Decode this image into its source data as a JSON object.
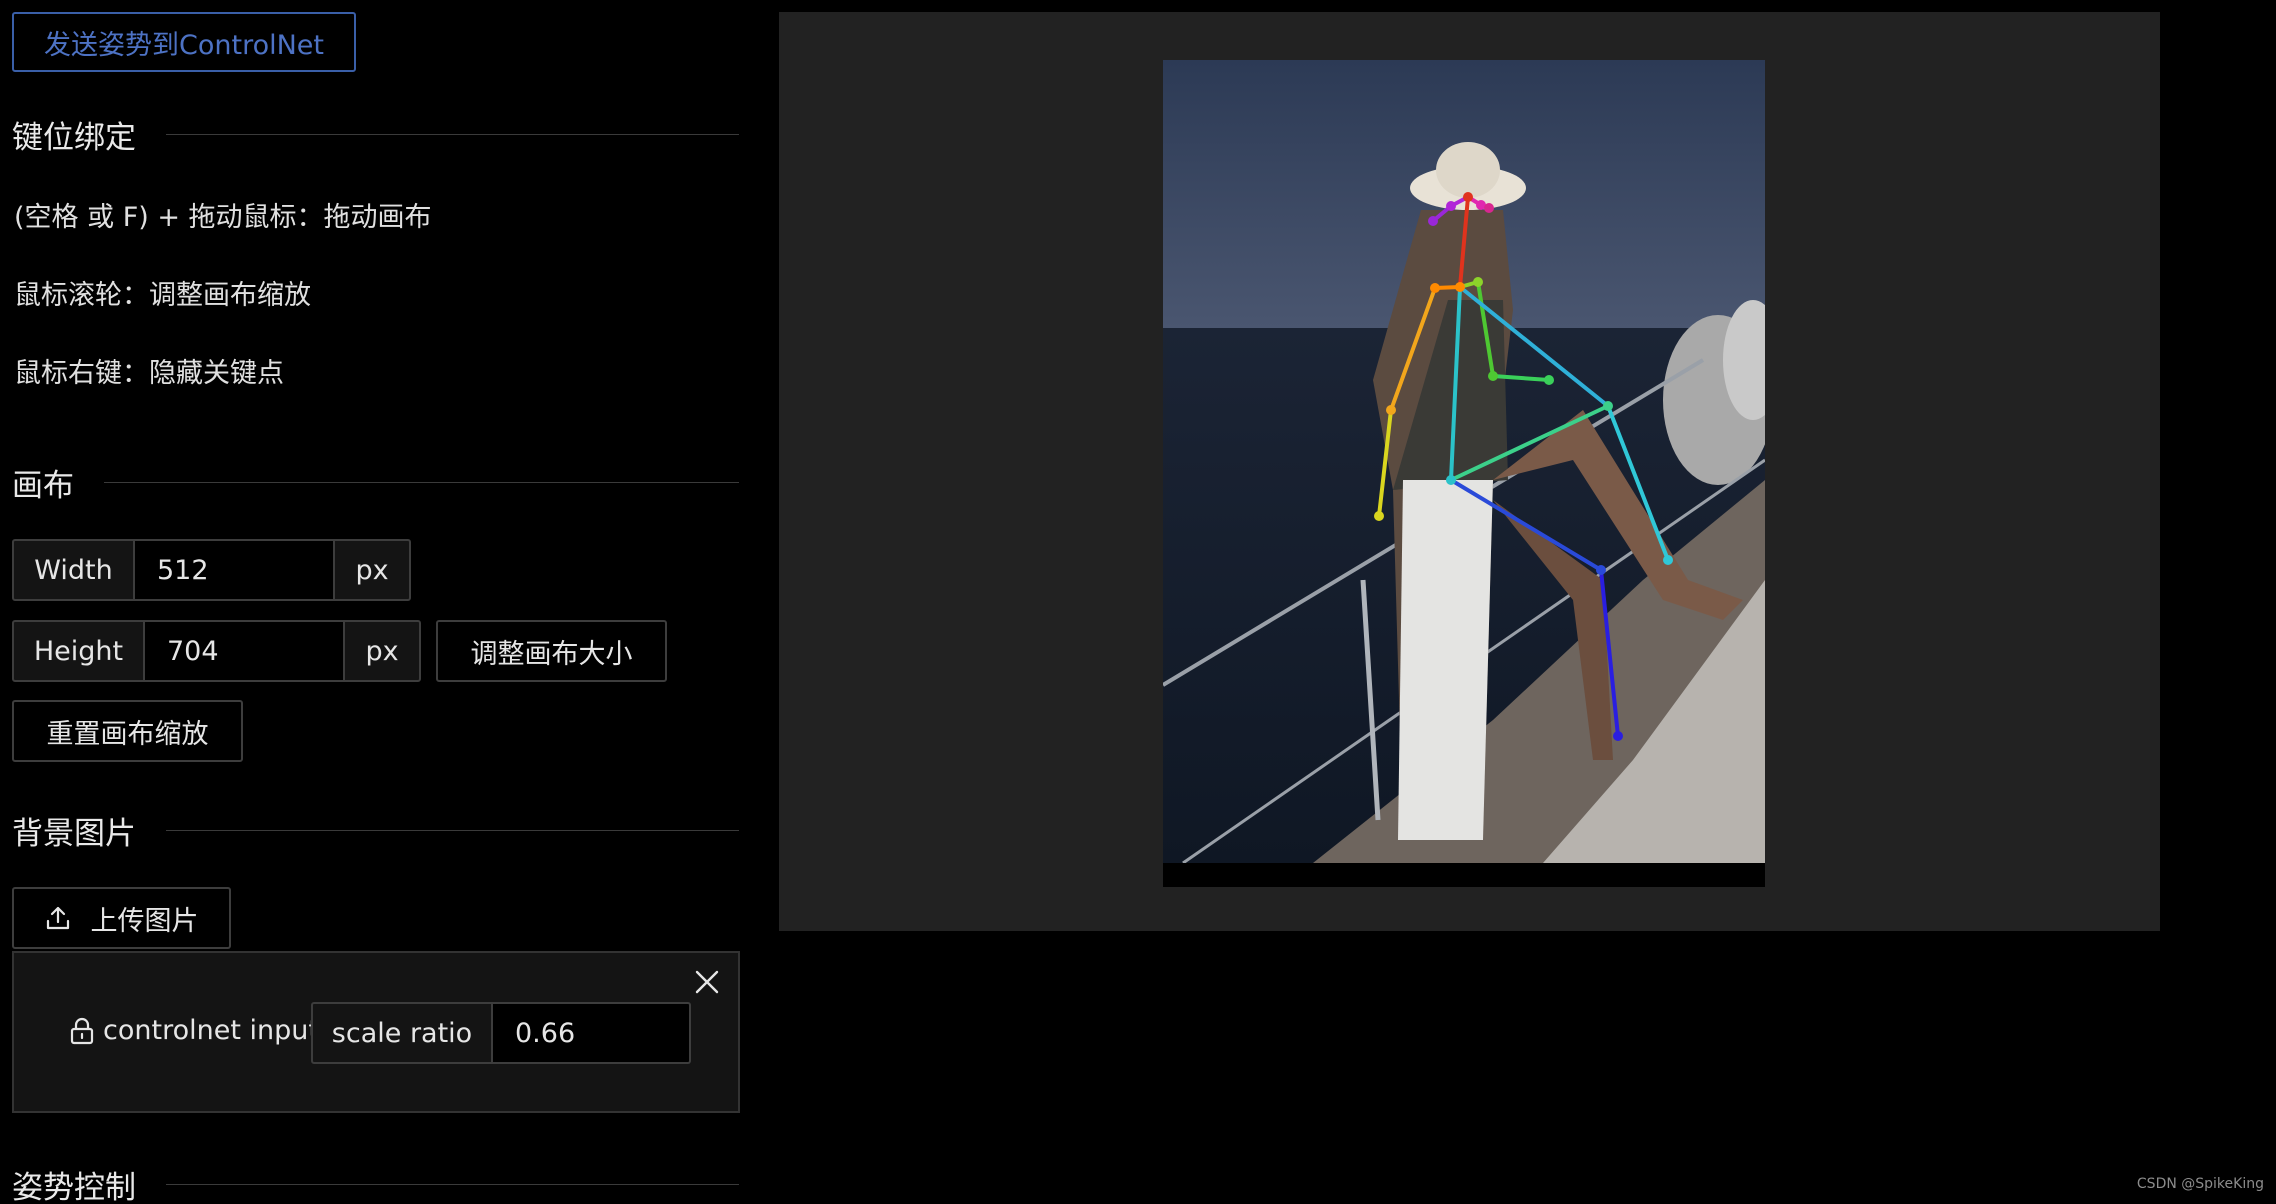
{
  "header": {
    "send_button": "发送姿势到ControlNet"
  },
  "keybind": {
    "title": "键位绑定",
    "hints": [
      "(空格 或 F) + 拖动鼠标：拖动画布",
      "鼠标滚轮：调整画布缩放",
      "鼠标右键：隐藏关键点"
    ]
  },
  "canvas": {
    "title": "画布",
    "width_label": "Width",
    "width_value": "512",
    "height_label": "Height",
    "height_value": "704",
    "unit": "px",
    "resize_button": "调整画布大小",
    "reset_zoom_button": "重置画布缩放"
  },
  "background": {
    "title": "背景图片",
    "upload_button": "上传图片",
    "card": {
      "lock_label": "controlnet input",
      "scale_label": "scale ratio",
      "scale_value": "0.66"
    }
  },
  "pose": {
    "title": "姿势控制"
  },
  "footer": {
    "credit": "CSDN @SpikeKing"
  },
  "colors": {
    "accent": "#4d72c4",
    "panel_bg": "#222222"
  },
  "icons": [
    "upload-icon",
    "close-icon",
    "lock-icon"
  ]
}
